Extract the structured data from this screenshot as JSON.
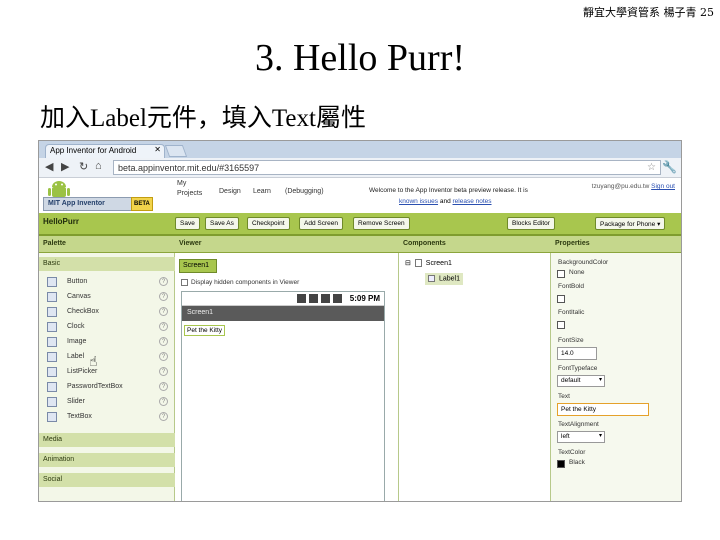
{
  "slide": {
    "corner": "靜宜大學資管系 楊子青 25",
    "title": "3. Hello Purr!",
    "subtitle": "加入Label元件，填入Text屬性"
  },
  "browser": {
    "tab_title": "App Inventor for Android",
    "url": "beta.appinventor.mit.edu/#3165597"
  },
  "app": {
    "mit_badge": "MIT App Inventor",
    "beta_badge": "BETA",
    "menu_my": "My",
    "menu_projects": "Projects",
    "menu_design": "Design",
    "menu_learn": "Learn",
    "menu_debugging": "(Debugging)",
    "welcome_text": "Welcome to the App Inventor beta preview release. It is",
    "welcome_link1": "known issues",
    "welcome_and": " and ",
    "welcome_link2": "release notes",
    "user_email": "tzuyang@pu.edu.tw",
    "sign_out": "Sign out",
    "project_name": "HelloPurr",
    "buttons": [
      "Save",
      "Save As",
      "Checkpoint",
      "Add Screen",
      "Remove Screen"
    ],
    "build_buttons": [
      "Blocks Editor",
      "Package for Phone"
    ],
    "build_arrow": "▾"
  },
  "columns": {
    "palette": "Palette",
    "viewer": "Viewer",
    "components": "Components",
    "properties": "Properties"
  },
  "palette": {
    "basic": "Basic",
    "items": [
      "Button",
      "Canvas",
      "CheckBox",
      "Clock",
      "Image",
      "Label",
      "ListPicker",
      "PasswordTextBox",
      "Slider",
      "TextBox"
    ],
    "help_glyph": "?",
    "media": "Media",
    "animation": "Animation",
    "social": "Social"
  },
  "viewer": {
    "screen_button": "Screen1",
    "hidden_checkbox": "Display hidden components in Viewer",
    "phone_time": "5:09 PM",
    "phone_title": "Screen1",
    "label_text": "Pet the Kitty"
  },
  "components": {
    "screen": "Screen1",
    "label": "Label1",
    "toggle": "⊟"
  },
  "properties": {
    "background_label": "BackgroundColor",
    "background_value": "None",
    "fontbold_label": "FontBold",
    "fontitalic_label": "FontItalic",
    "fontsize_label": "FontSize",
    "fontsize_value": "14.0",
    "fonttypeface_label": "FontTypeface",
    "fonttypeface_value": "default",
    "text_label": "Text",
    "text_value": "Pet the Kitty",
    "textalign_label": "TextAlignment",
    "textalign_value": "left",
    "textcolor_label": "TextColor",
    "textcolor_value": "Black",
    "select_arrow": "▾"
  },
  "colors": {
    "app_green": "#a8c64e",
    "column_head": "#c5d78c",
    "active_input": "#e5a12a",
    "link": "#2a4fb0"
  }
}
